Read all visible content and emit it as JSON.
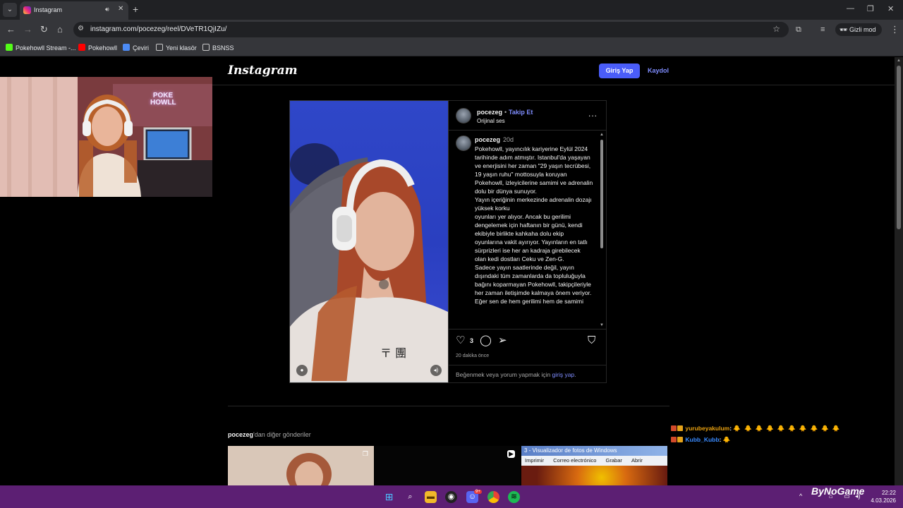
{
  "browser": {
    "tab_title": "Instagram",
    "new_tab": "+",
    "url": "instagram.com/pocezeg/reel/DVeTR1QjIZu/",
    "incognito_label": "Gizli mod",
    "bookmarks": [
      {
        "label": "Pokehowll Stream -..."
      },
      {
        "label": "Pokehowll"
      },
      {
        "label": "Çeviri"
      },
      {
        "label": "Yeni klasör"
      },
      {
        "label": "BSNSS"
      }
    ]
  },
  "instagram": {
    "logo": "Instagram",
    "login_button": "Giriş Yap",
    "signup_link": "Kaydol"
  },
  "post": {
    "username": "pocezeg",
    "follow_separator": "•",
    "follow_label": "Takip Et",
    "audio": "Orijinal ses",
    "more": "...",
    "caption_user": "pocezeg",
    "caption_time": "20d",
    "caption_text": "Pokehowll, yayıncılık kariyerine Eylül 2024 tarihinde adım atmıştır. Istanbul'da yaşayan ve enerjisini her zaman \"29 yaşın tecrübesi, 19 yaşın ruhu\" mottosuyla koruyan Pokehowll, izleyicilerine samimi ve adrenalin dolu bir dünya sunuyor.\nYayın içeriğinin merkezinde adrenalin dozajı yüksek korku\noyunları yer alıyor. Ancak bu gerilimi dengelemek için haftanın bir günü, kendi ekibiyle birlikte kahkaha dolu ekip oyunlarına vakit ayırıyor. Yayınların en tatlı sürprizleri ise her an kadraja girebilecek olan kedi dostları Ceku ve Zen-G.\nSadece yayın saatlerinde değil, yayın dışındaki tüm zamanlarda da topluluğuyla bağını koparmayan Pokehowll, takipçileriyle her zaman iletişimde kalmaya önem veriyor. Eğer sen de hem gerilimi hem de samimi",
    "likes": "3",
    "posted_ago": "20 dakika önce",
    "login_prompt_prefix": "Beğenmek veya yorum yapmak için ",
    "login_prompt_link": "giriş yap",
    "login_prompt_suffix": "."
  },
  "more_posts": {
    "user": "pocezeg",
    "suffix": "'dan diğer gönderiler",
    "window_title": "3 - Visualizador de fotos de Windows",
    "window_menu": [
      "Imprimir",
      "Correo electrónico",
      "Grabar",
      "Abrir"
    ]
  },
  "chat": [
    {
      "user": "yurubeyakulum",
      "sep": ":",
      "color": "#e8a010",
      "emotes": "🐥🐥🐥🐥🐥🐥🐥🐥🐥🐥"
    },
    {
      "user": "Kubb_Kubb",
      "sep": ":",
      "color": "#3a8bff",
      "emotes": "🐥"
    }
  ],
  "webcam": {
    "neon_sign": "POKE HOWLL"
  },
  "taskbar": {
    "watermark": "ByNoGame",
    "time": "22:22",
    "date": "4.03.2026",
    "discord_badge": "9+"
  }
}
